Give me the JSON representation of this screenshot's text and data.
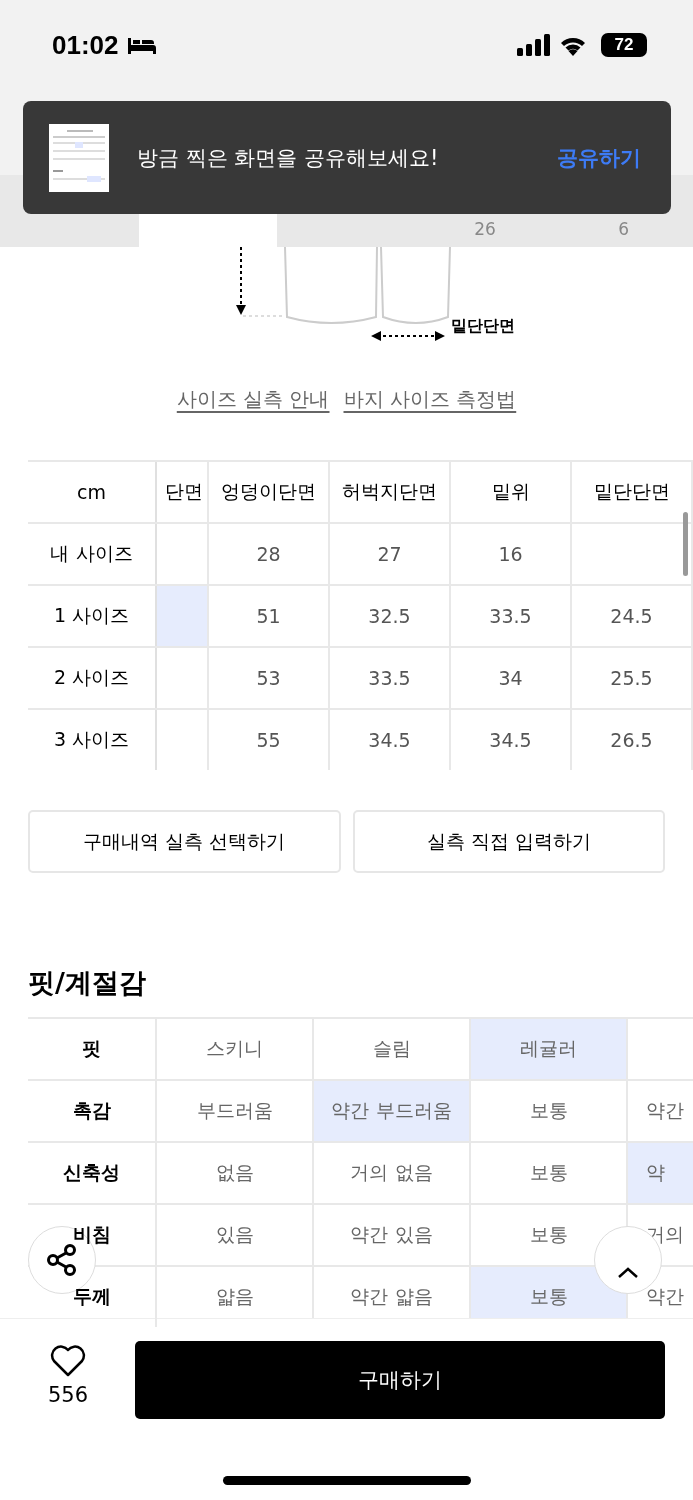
{
  "status_bar": {
    "time": "01:02",
    "battery": "72"
  },
  "toast": {
    "message": "방금 찍은 화면을 공유해보세요!",
    "action": "공유하기"
  },
  "tabs": [
    {
      "selected": false
    },
    {
      "selected": true
    },
    {
      "selected": false
    },
    {
      "count": "26",
      "selected": false
    },
    {
      "count": "6",
      "selected": false
    }
  ],
  "diagram": {
    "label": "밑단단면"
  },
  "links": [
    "사이즈 실측 안내",
    "바지 사이즈 측정법"
  ],
  "size_table": {
    "corner": "cm",
    "columns": [
      "단면",
      "엉덩이단면",
      "허벅지단면",
      "밑위",
      "밑단단면"
    ],
    "rows": [
      {
        "label": "내 사이즈",
        "cells": [
          {
            "selected": false
          },
          {
            "text": "28",
            "selected": false
          },
          {
            "text": "27",
            "selected": false
          },
          {
            "text": "16",
            "selected": false
          },
          {
            "selected": false
          }
        ]
      },
      {
        "label": "1 사이즈",
        "cells": [
          {
            "selected": true
          },
          {
            "text": "51",
            "selected": false
          },
          {
            "text": "32.5",
            "selected": false
          },
          {
            "text": "33.5",
            "selected": false
          },
          {
            "text": "24.5",
            "selected": false
          }
        ]
      },
      {
        "label": "2 사이즈",
        "cells": [
          {
            "selected": false
          },
          {
            "text": "53",
            "selected": false
          },
          {
            "text": "33.5",
            "selected": false
          },
          {
            "text": "34",
            "selected": false
          },
          {
            "text": "25.5",
            "selected": false
          }
        ]
      },
      {
        "label": "3 사이즈",
        "cells": [
          {
            "selected": false
          },
          {
            "text": "55",
            "selected": false
          },
          {
            "text": "34.5",
            "selected": false
          },
          {
            "text": "34.5",
            "selected": false
          },
          {
            "text": "26.5",
            "selected": false
          }
        ]
      }
    ]
  },
  "actions": [
    "구매내역 실측 선택하기",
    "실측 직접 입력하기"
  ],
  "fit_section": {
    "title": "핏/계절감",
    "rows": [
      {
        "label": "핏",
        "options": [
          {
            "text": "스키니",
            "selected": false
          },
          {
            "text": "슬림",
            "selected": false
          },
          {
            "text": "레귤러",
            "selected": true
          },
          {
            "selected": false
          }
        ]
      },
      {
        "label": "촉감",
        "options": [
          {
            "text": "부드러움",
            "selected": false
          },
          {
            "text": "약간 부드러움",
            "selected": true
          },
          {
            "text": "보통",
            "selected": false
          },
          {
            "text": "약간",
            "selected": false
          }
        ]
      },
      {
        "label": "신축성",
        "options": [
          {
            "text": "없음",
            "selected": false
          },
          {
            "text": "거의 없음",
            "selected": false
          },
          {
            "text": "보통",
            "selected": false
          },
          {
            "text": "약",
            "selected": true
          }
        ]
      },
      {
        "label": "비침",
        "options": [
          {
            "text": "있음",
            "selected": false
          },
          {
            "text": "약간 있음",
            "selected": false
          },
          {
            "text": "보통",
            "selected": false
          },
          {
            "text": "거의",
            "selected": false
          }
        ]
      },
      {
        "label": "두께",
        "options": [
          {
            "text": "얇음",
            "selected": false
          },
          {
            "text": "약간 얇음",
            "selected": false
          },
          {
            "text": "보통",
            "selected": true
          },
          {
            "text": "약간",
            "selected": false
          }
        ]
      }
    ]
  },
  "bottom_bar": {
    "likes": "556",
    "buy": "구매하기"
  }
}
